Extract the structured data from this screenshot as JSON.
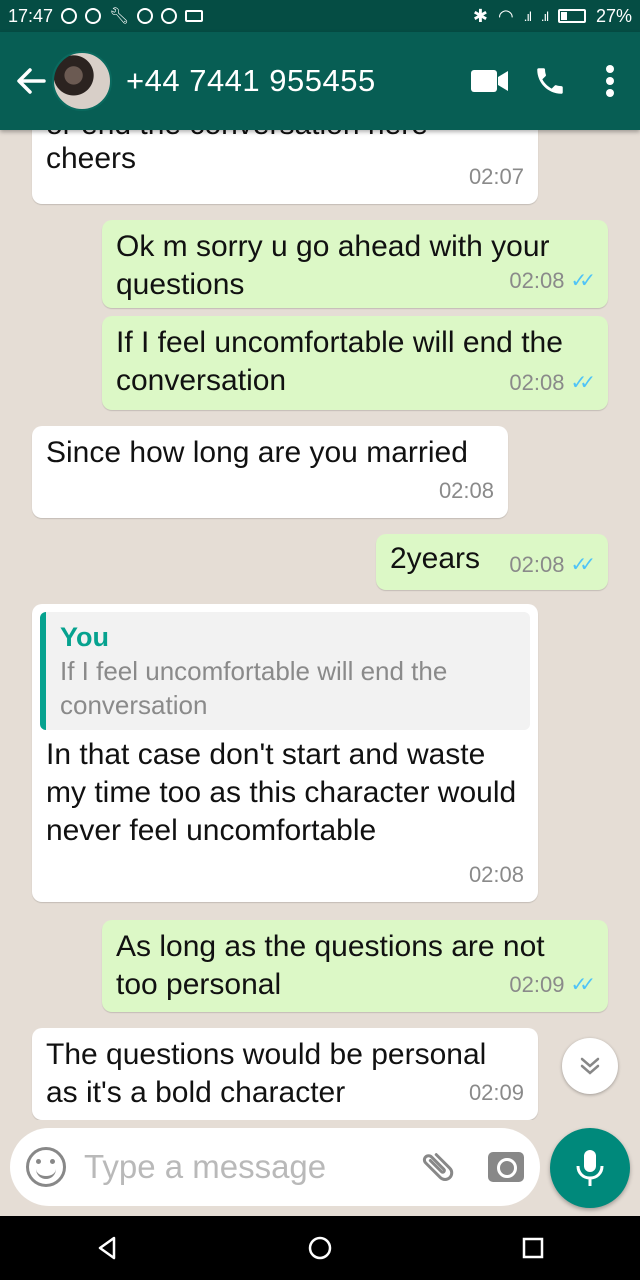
{
  "status_bar": {
    "time": "17:47",
    "battery": "27%"
  },
  "header": {
    "contact": "+44 7441 955455",
    "icons": [
      "back-arrow-icon",
      "avatar",
      "video-call-icon",
      "phone-call-icon",
      "more-vert-icon"
    ]
  },
  "messages": [
    {
      "dir": "in",
      "text_top": "or end the conversation here",
      "text": "cheers",
      "time": "02:07"
    },
    {
      "dir": "out",
      "text": "Ok m sorry u go ahead with your questions",
      "time": "02:08",
      "ticks": "✓✓"
    },
    {
      "dir": "out",
      "text": "If I feel uncomfortable will end the conversation",
      "time": "02:08",
      "ticks": "✓✓"
    },
    {
      "dir": "in",
      "text": "Since how long are you married",
      "time": "02:08"
    },
    {
      "dir": "out",
      "text": "2years",
      "time": "02:08",
      "ticks": "✓✓"
    },
    {
      "dir": "in",
      "quote_author": "You",
      "quote_text": "If I feel uncomfortable will end the conversation",
      "text": "In that case don't start and waste my time too as this character would never feel uncomfortable",
      "time": "02:08"
    },
    {
      "dir": "out",
      "text": "As long as the questions are not too personal",
      "time": "02:09",
      "ticks": "✓✓"
    },
    {
      "dir": "in",
      "text": "The questions would be personal as it's a bold character",
      "time": "02:09"
    }
  ],
  "input": {
    "placeholder": "Type a message"
  },
  "colors": {
    "appbar": "#075e54",
    "statusbar": "#054d44",
    "outgoing_bubble": "#dcf8c6",
    "incoming_bubble": "#ffffff",
    "accent": "#00897b",
    "read_ticks": "#4fc3f7"
  }
}
